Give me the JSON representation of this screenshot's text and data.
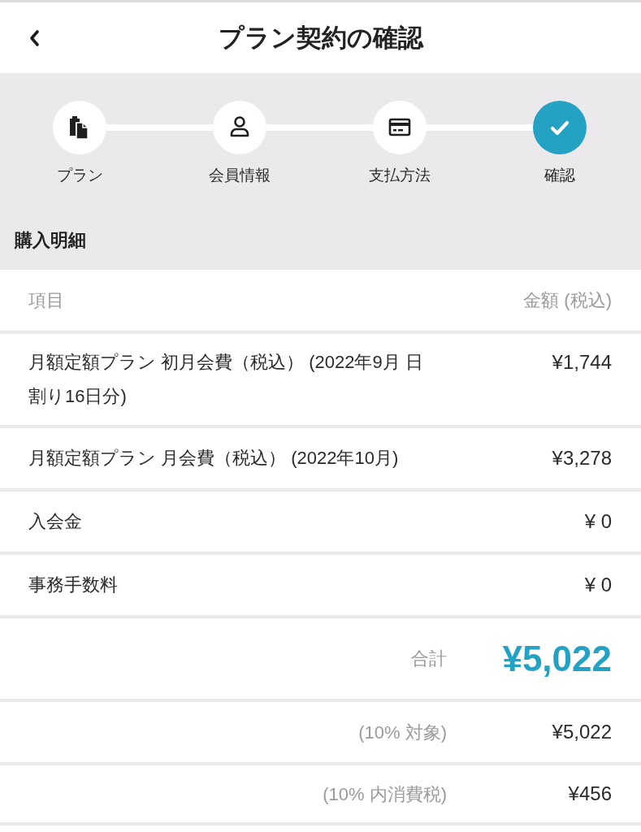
{
  "header": {
    "title": "プラン契約の確認"
  },
  "steps": [
    {
      "label": "プラン",
      "kind": "plan",
      "selected": false
    },
    {
      "label": "会員情報",
      "kind": "member",
      "selected": false
    },
    {
      "label": "支払方法",
      "kind": "payment",
      "selected": false
    },
    {
      "label": "確認",
      "kind": "confirm",
      "selected": true
    }
  ],
  "section_title": "購入明細",
  "table": {
    "columns": [
      "項目",
      "金額 (税込)"
    ],
    "rows": [
      {
        "item": "月額定額プラン 初月会費（税込） (2022年9月 日割り16日分)",
        "amount": "¥1,744"
      },
      {
        "item": "月額定額プラン 月会費（税込） (2022年10月)",
        "amount": "¥3,278"
      },
      {
        "item": "入会金",
        "amount": "¥ 0"
      },
      {
        "item": "事務手数料",
        "amount": "¥ 0"
      }
    ]
  },
  "total": {
    "label": "合計",
    "amount": "¥5,022"
  },
  "tax_rows": [
    {
      "label": "(10% 対象)",
      "amount": "¥5,022"
    },
    {
      "label": "(10% 内消費税)",
      "amount": "¥456"
    }
  ]
}
